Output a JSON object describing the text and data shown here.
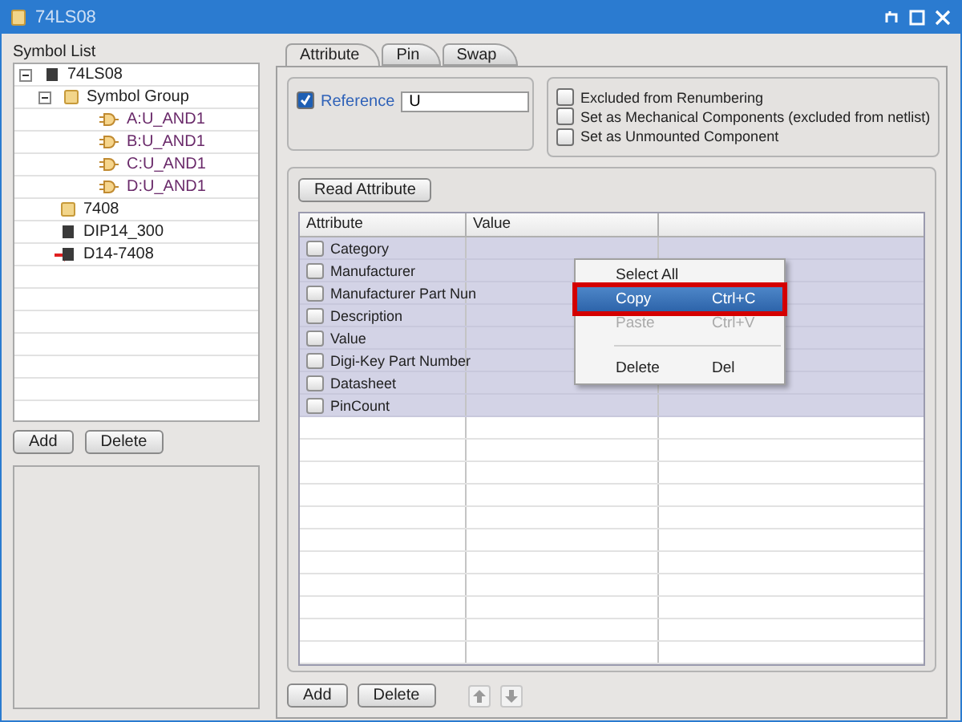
{
  "window": {
    "title": "74LS08"
  },
  "symbol_list": {
    "label": "Symbol List",
    "tree": [
      {
        "label": "74LS08",
        "kind": "chip",
        "expanded": true,
        "current": false,
        "children": [
          {
            "label": "Symbol Group",
            "kind": "folder",
            "expanded": true,
            "current": false,
            "children": [
              {
                "label": "A:U_AND1",
                "kind": "gate",
                "current": false
              },
              {
                "label": "B:U_AND1",
                "kind": "gate",
                "current": false
              },
              {
                "label": "C:U_AND1",
                "kind": "gate",
                "current": false
              },
              {
                "label": "D:U_AND1",
                "kind": "gate",
                "current": false
              }
            ]
          },
          {
            "label": "7408",
            "kind": "folder",
            "current": false
          },
          {
            "label": "DIP14_300",
            "kind": "chip",
            "current": false
          },
          {
            "label": "D14-7408",
            "kind": "chip",
            "current": true
          }
        ]
      }
    ],
    "buttons": [
      "Add",
      "Delete"
    ]
  },
  "tabs": [
    {
      "label": "Attribute",
      "selected": true
    },
    {
      "label": "Pin",
      "selected": false
    },
    {
      "label": "Swap",
      "selected": false
    }
  ],
  "reference": {
    "label": "Reference",
    "checked": true,
    "value": "U"
  },
  "options": [
    {
      "label": "Excluded from Renumbering",
      "checked": false
    },
    {
      "label": "Set as Mechanical Components (excluded from netlist)",
      "checked": false
    },
    {
      "label": "Set as Unmounted Component",
      "checked": false
    }
  ],
  "read_button": "Read Attribute",
  "table": {
    "columns": [
      "Attribute",
      "Value"
    ],
    "rows": [
      {
        "attribute": "Category",
        "checked": false,
        "selected": true
      },
      {
        "attribute": "Manufacturer",
        "checked": false,
        "selected": true
      },
      {
        "attribute": "Manufacturer Part Nun",
        "checked": false,
        "selected": true
      },
      {
        "attribute": "Description",
        "checked": false,
        "selected": true
      },
      {
        "attribute": "Value",
        "checked": false,
        "selected": true
      },
      {
        "attribute": "Digi-Key Part Number",
        "checked": false,
        "selected": true
      },
      {
        "attribute": "Datasheet",
        "checked": false,
        "selected": true
      },
      {
        "attribute": "PinCount",
        "checked": false,
        "selected": true
      }
    ]
  },
  "context_menu": [
    {
      "kind": "item",
      "label": "Select All",
      "selected": false,
      "disabled": false
    },
    {
      "kind": "item",
      "label": "Copy",
      "shortcut": "Ctrl+C",
      "selected": true,
      "disabled": false
    },
    {
      "kind": "item",
      "label": "Paste",
      "shortcut": "Ctrl+V",
      "selected": false,
      "disabled": true
    },
    {
      "kind": "separator"
    },
    {
      "kind": "item",
      "label": "Delete",
      "shortcut": "Del",
      "selected": false,
      "disabled": false
    }
  ],
  "bottom_buttons": [
    "Add",
    "Delete"
  ]
}
